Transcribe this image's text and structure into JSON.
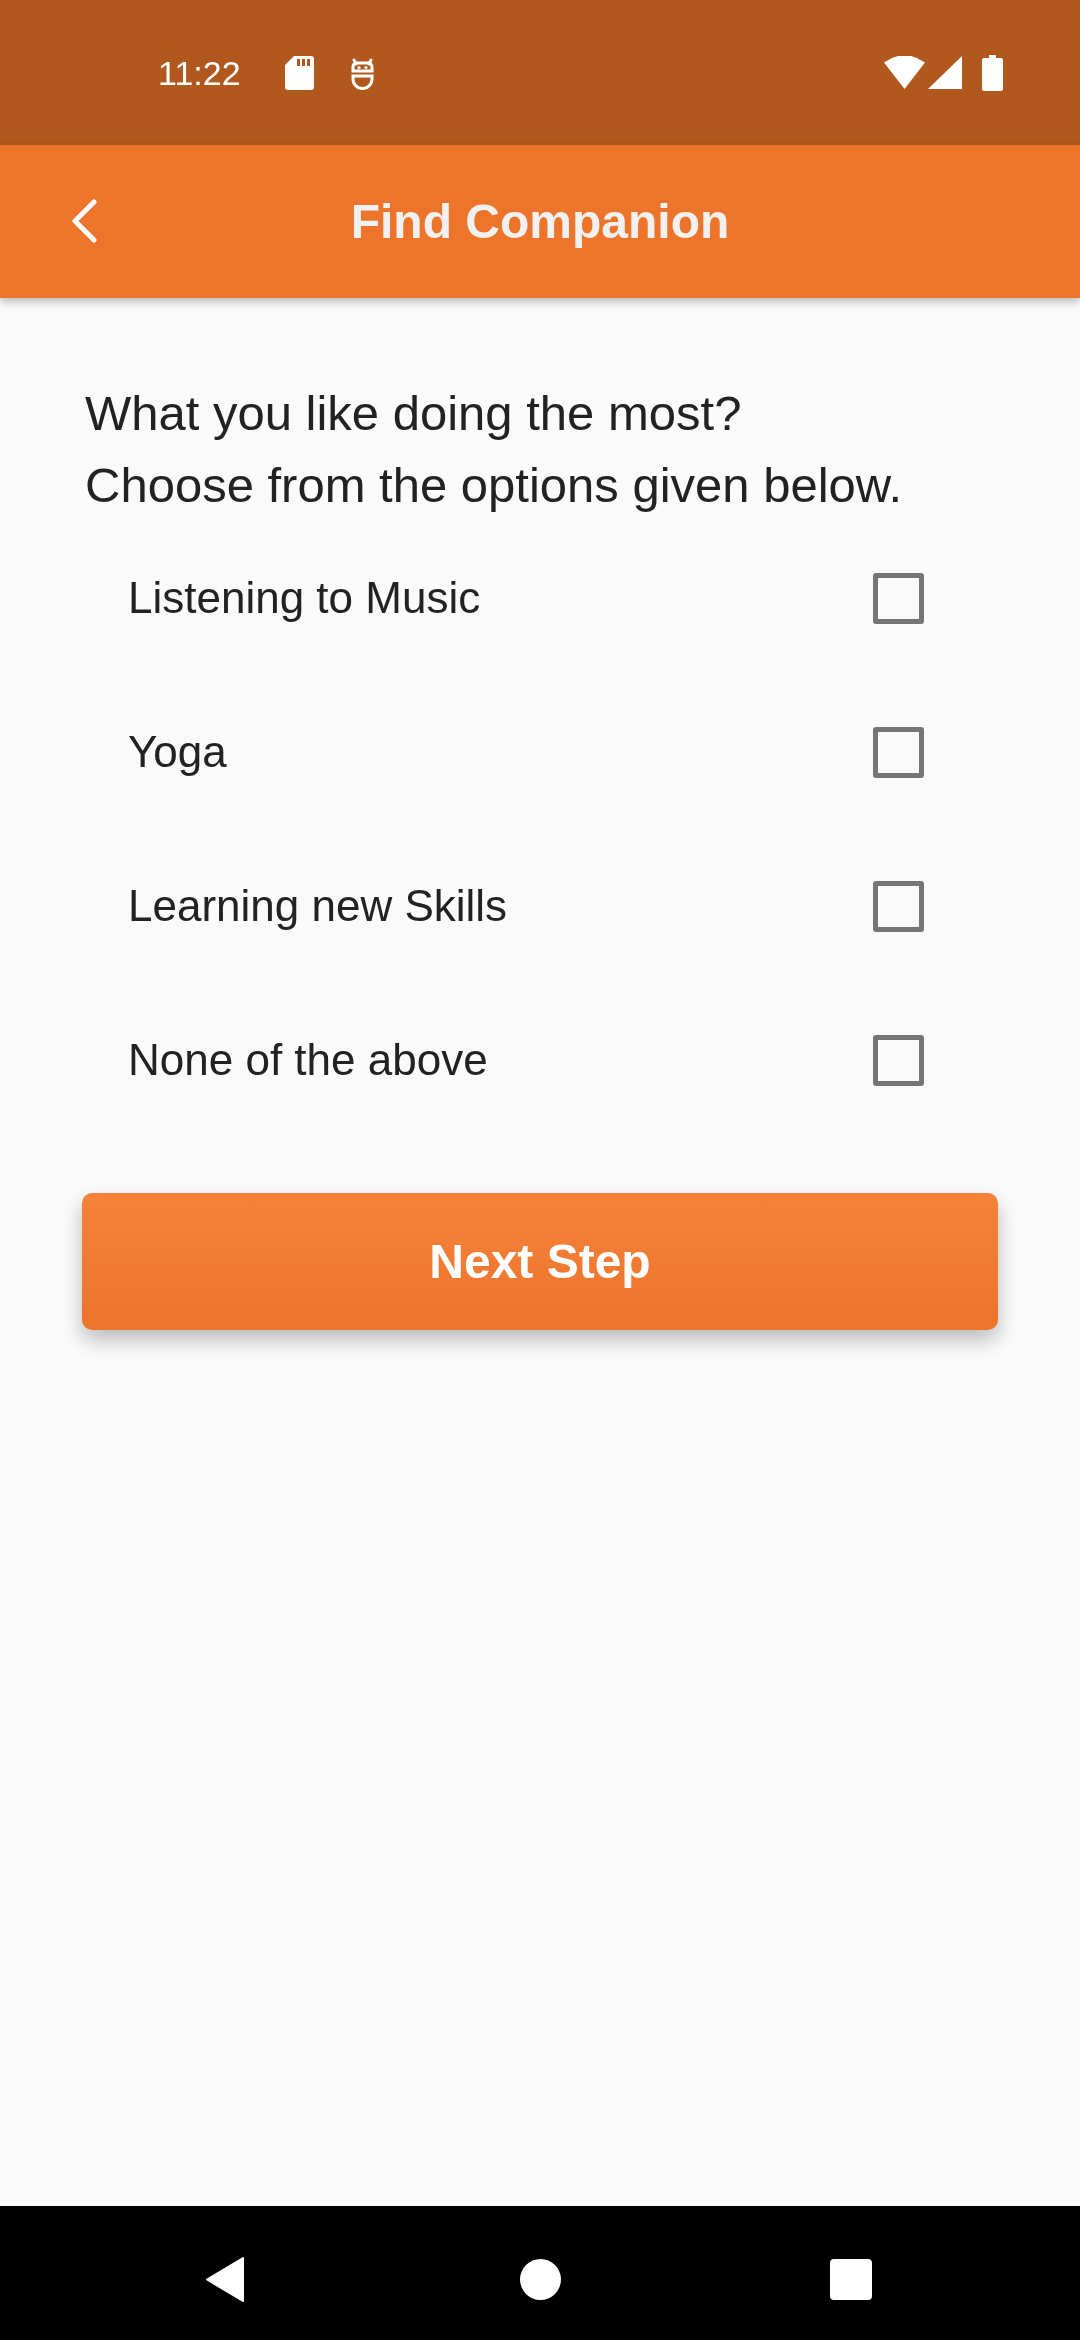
{
  "status_bar": {
    "time": "11:22"
  },
  "app_bar": {
    "title": "Find Companion"
  },
  "question": {
    "text": "What you like doing the most?",
    "instruction": "Choose from the options given below."
  },
  "options": [
    {
      "label": "Listening to Music",
      "checked": false
    },
    {
      "label": "Yoga",
      "checked": false
    },
    {
      "label": "Learning new Skills",
      "checked": false
    },
    {
      "label": "None of the above",
      "checked": false
    }
  ],
  "next_button": {
    "label": "Next Step"
  }
}
